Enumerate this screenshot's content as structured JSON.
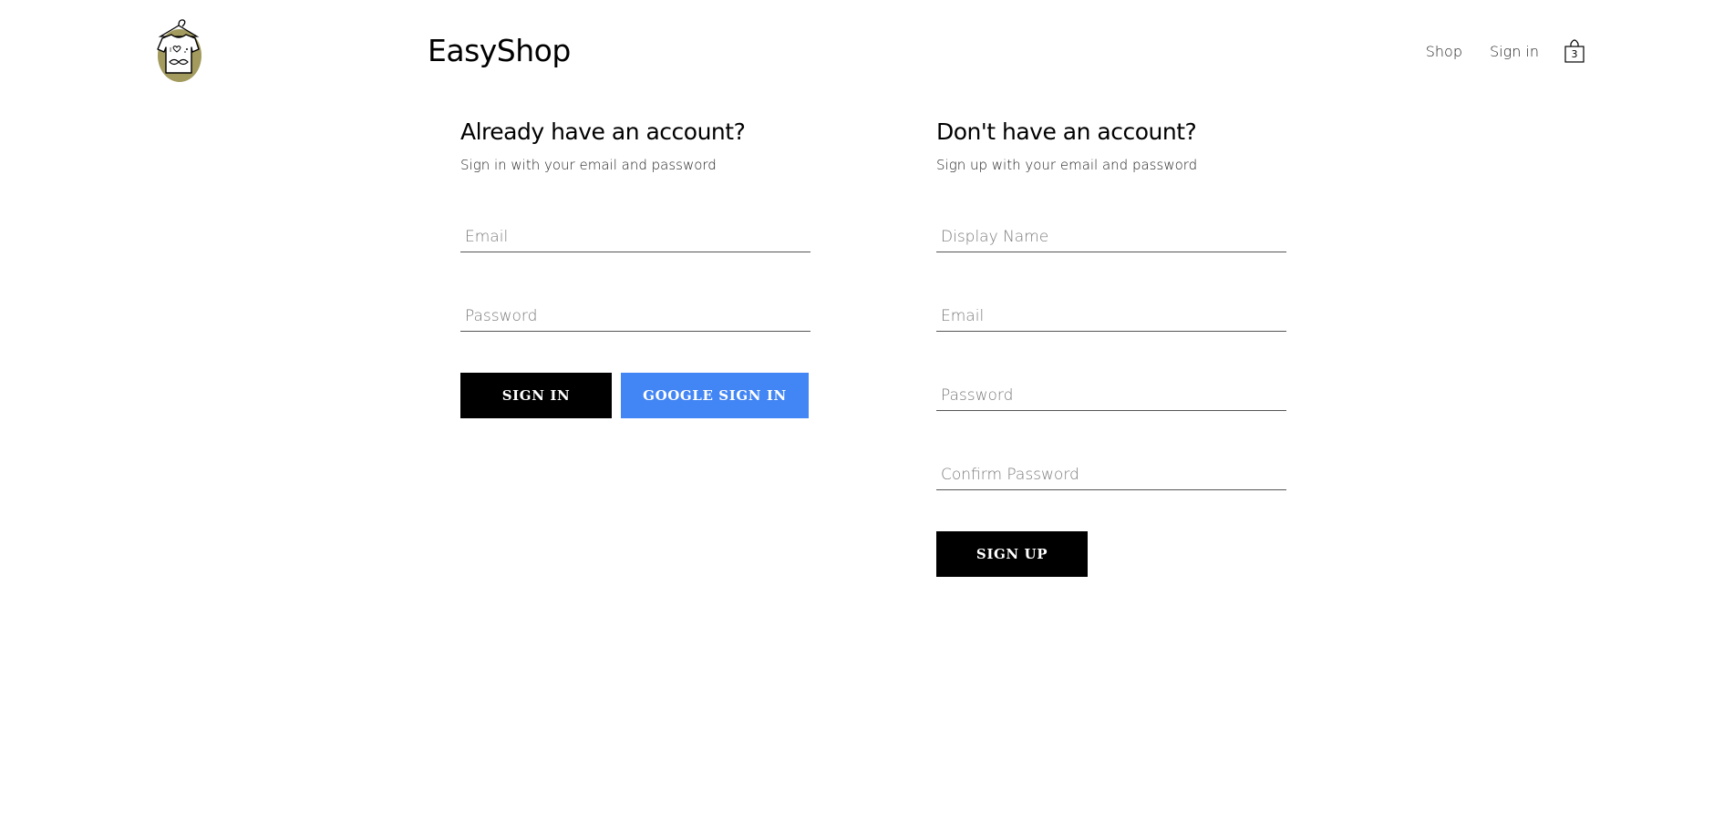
{
  "header": {
    "brand": "EasyShop",
    "nav": {
      "shop_label": "Shop",
      "signin_label": "Sign in",
      "cart_count": "3"
    }
  },
  "signin": {
    "title": "Already have an account?",
    "subtitle": "Sign in with your email and password",
    "email_placeholder": "Email",
    "password_placeholder": "Password",
    "signin_button": "SIGN IN",
    "google_button": "GOOGLE SIGN IN"
  },
  "signup": {
    "title": "Don't have an account?",
    "subtitle": "Sign up with your email and password",
    "display_name_placeholder": "Display Name",
    "email_placeholder": "Email",
    "password_placeholder": "Password",
    "confirm_password_placeholder": "Confirm Password",
    "signup_button": "SIGN UP"
  },
  "colors": {
    "primary_button": "#000000",
    "google_button": "#4285f4",
    "logo_blob": "#a39a5e"
  },
  "icons": {
    "logo": "shirt-on-hanger-logo-icon",
    "cart": "shopping-bag-icon"
  }
}
